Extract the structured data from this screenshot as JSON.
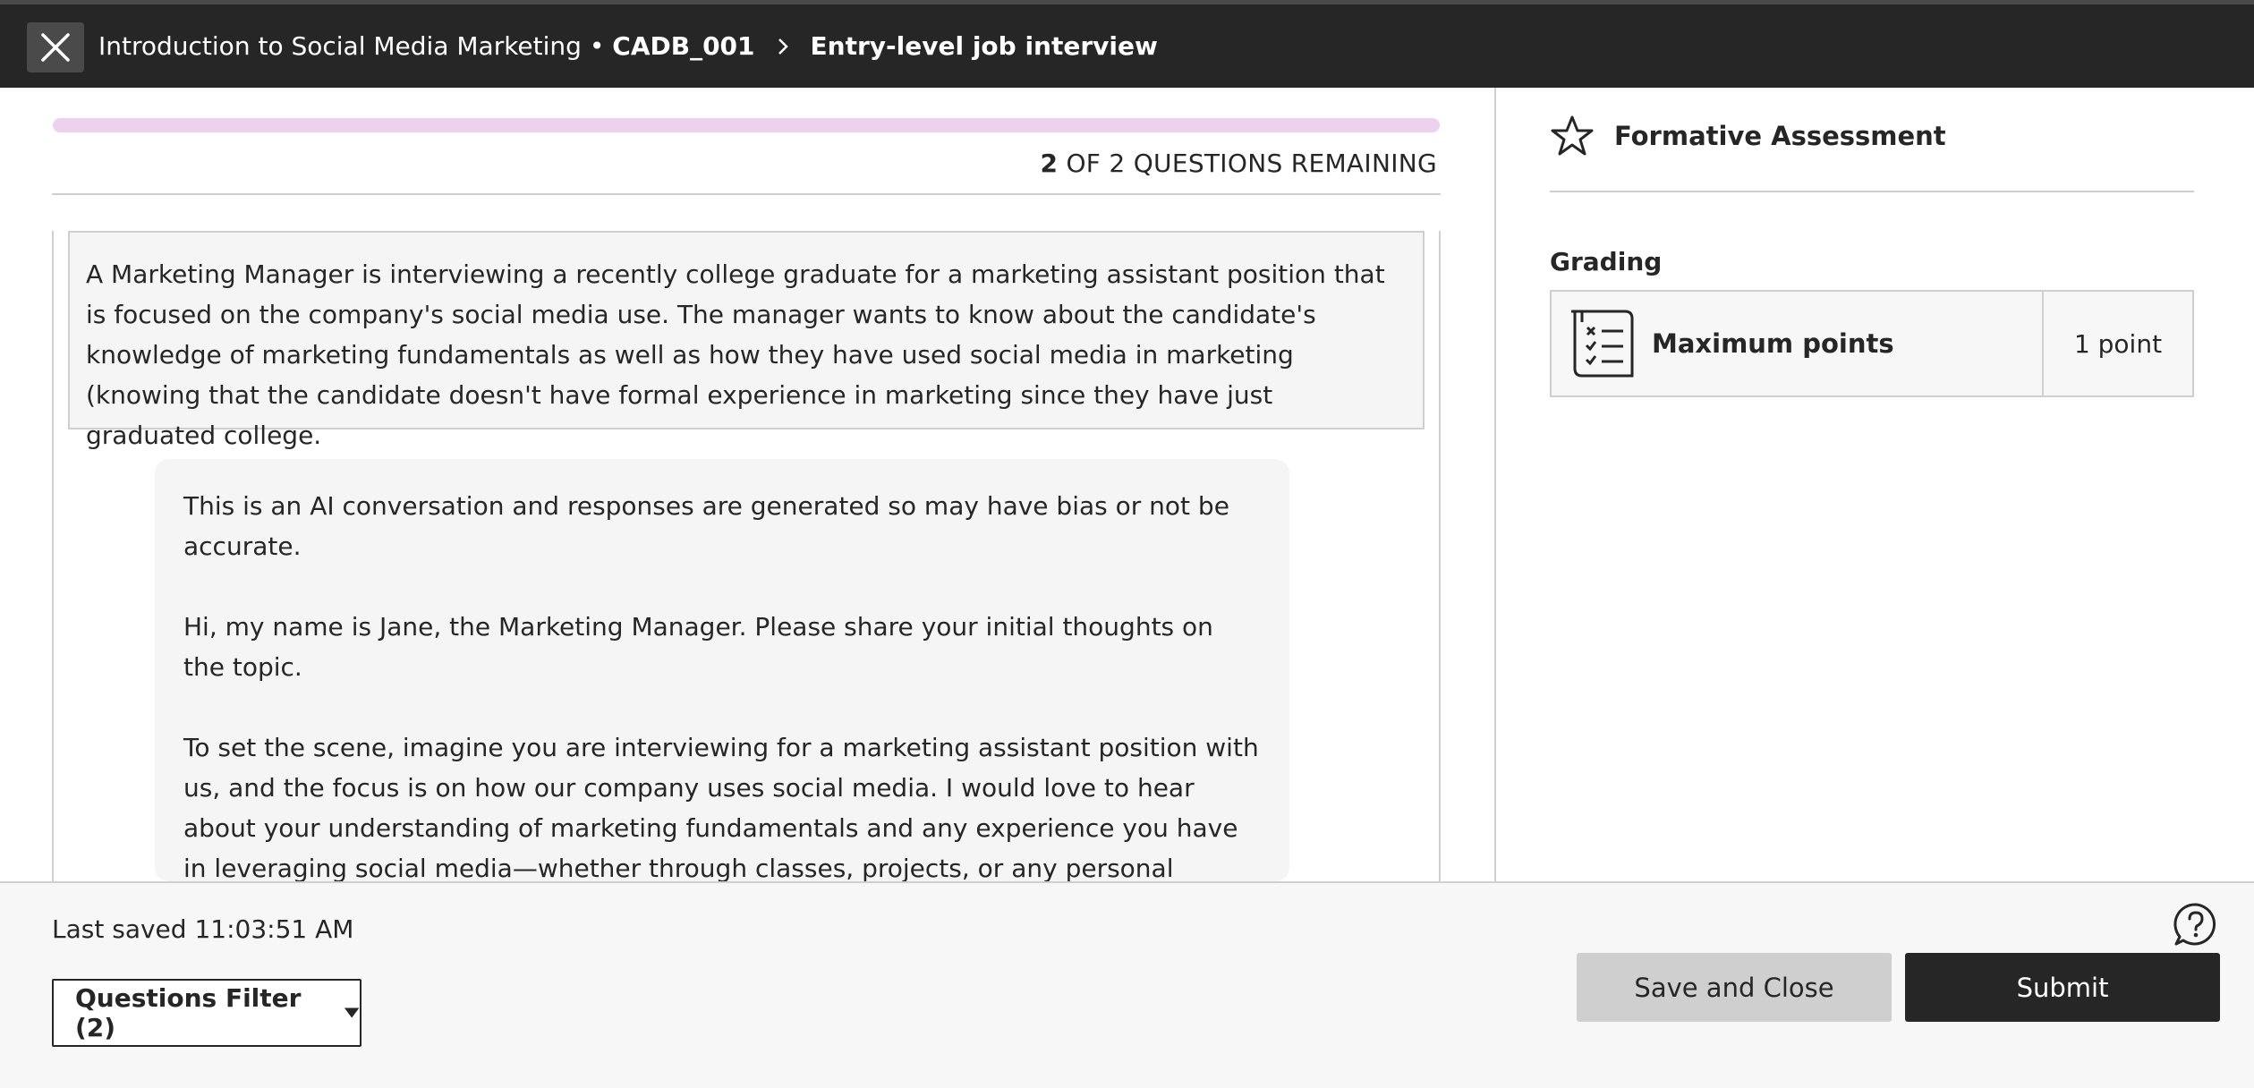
{
  "header": {
    "course_name": "Introduction to Social Media Marketing",
    "course_separator": " • ",
    "course_code": "CADB_001",
    "current_page": "Entry-level job interview"
  },
  "progress": {
    "remaining_count": "2",
    "remaining_text": " OF 2 QUESTIONS REMAINING",
    "fraction_complete": 0.0
  },
  "question": {
    "prompt": "A Marketing Manager is interviewing a recently college graduate for a marketing assistant position that is focused on the company's social media use. The manager wants to know about the candidate's knowledge of marketing fundamentals as well as how they have used social media in marketing (knowing that the candidate doesn't have formal experience in marketing since they have just graduated college."
  },
  "conversation": {
    "disclaimer": "This is an AI conversation and responses are generated so may have bias or not be accurate.",
    "greeting": "Hi, my name is Jane, the Marketing Manager. Please share your initial thoughts on the topic.",
    "scene": "To set the scene, imagine you are interviewing for a marketing assistant position with us, and the focus is on how our company uses social media. I would love to hear about your understanding of marketing fundamentals and any experience you have in leveraging social media—whether through classes, projects, or any personal initiatives—to achieve marketing goals. Let's start there!"
  },
  "sidebar": {
    "assessment_type": "Formative Assessment",
    "grading_label": "Grading",
    "max_points_label": "Maximum points",
    "max_points_value": "1 point"
  },
  "footer": {
    "last_saved": "Last saved 11:03:51 AM",
    "filter_label": "Questions Filter (2)",
    "save_close_label": "Save and Close",
    "submit_label": "Submit"
  },
  "colors": {
    "header_bg": "#262626",
    "accent": "#b248bd",
    "progress_track": "#ecd2ee"
  }
}
